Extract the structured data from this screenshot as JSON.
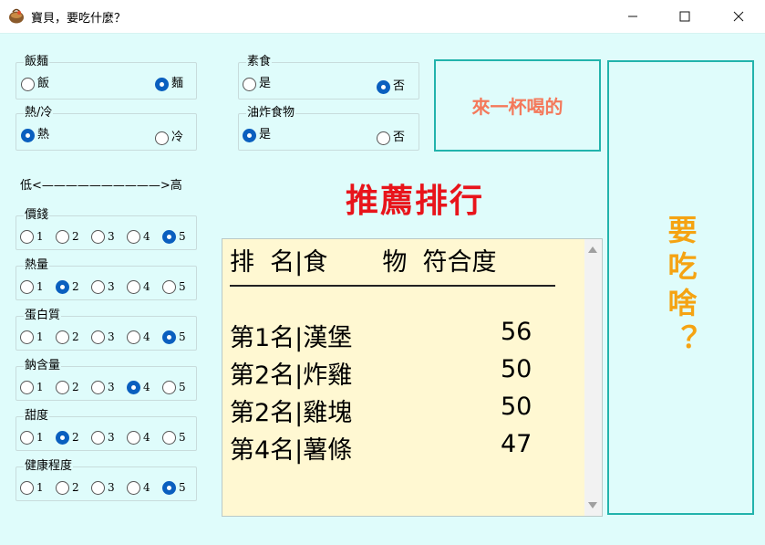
{
  "window": {
    "title": "寶貝，要吃什麼？",
    "icon": "basket-icon",
    "controls": {
      "minimize": "—",
      "maximize": "☐",
      "close": "✕"
    }
  },
  "options": {
    "rice_noodle": {
      "legend": "飯麵",
      "a": "飯",
      "b": "麵",
      "selected": "b"
    },
    "hot_cold": {
      "legend": "熱/冷",
      "a": "熱",
      "b": "冷",
      "selected": "a"
    },
    "vegetarian": {
      "legend": "素食",
      "a": "是",
      "b": "否",
      "selected": "b"
    },
    "fried": {
      "legend": "油炸食物",
      "a": "是",
      "b": "否",
      "selected": "a"
    }
  },
  "scale_label": "低<——————————>高",
  "scales": [
    {
      "legend": "價錢",
      "selected": 5
    },
    {
      "legend": "熱量",
      "selected": 2
    },
    {
      "legend": "蛋白質",
      "selected": 5
    },
    {
      "legend": "鈉含量",
      "selected": 4
    },
    {
      "legend": "甜度",
      "selected": 2
    },
    {
      "legend": "健康程度",
      "selected": 5
    }
  ],
  "scale_values": [
    "1",
    "2",
    "3",
    "4",
    "5"
  ],
  "drink_button": "來一杯喝的",
  "ranking_title": "推薦排行",
  "results": {
    "header": "排  名|食       物  符合度",
    "rows": [
      {
        "name": "第1名|漢堡",
        "score": "56"
      },
      {
        "name": "第2名|炸雞",
        "score": "50"
      },
      {
        "name": "第2名|雞塊",
        "score": "50"
      },
      {
        "name": "第4名|薯條",
        "score": "47"
      }
    ]
  },
  "eat_button": "要吃啥？",
  "colors": {
    "client_bg": "#dffcfb",
    "accent_border": "#22b3ac",
    "drink_text": "#f4795b",
    "ranking_title": "#e8141b",
    "eat_text": "#f5a312",
    "results_bg": "#fff8d2",
    "radio_checked": "#0a5fbf"
  }
}
